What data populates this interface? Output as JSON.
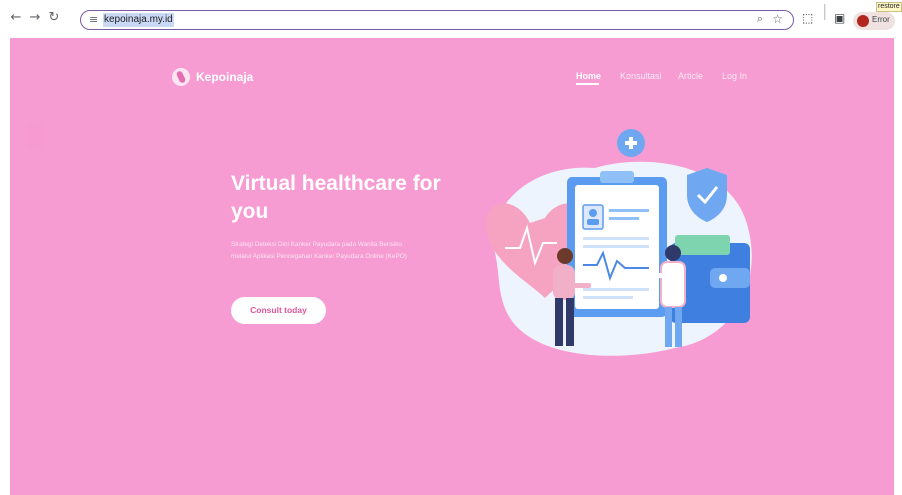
{
  "browser": {
    "back_icon": "←",
    "forward_icon": "→",
    "reload_icon": "↻",
    "tune_icon": "≡",
    "url": "kepoinaja.my.id",
    "zoom_icon": "⌕",
    "star_icon": "☆",
    "extensions_icon": "⬚",
    "sidebar_icon": "▣",
    "profile_label": "Error",
    "restore_label": "restore"
  },
  "site": {
    "brand": "Kepoinaja",
    "nav": {
      "home": "Home",
      "konsultasi": "Konsultasi",
      "article": "Article",
      "login": "Log In"
    }
  },
  "hero": {
    "title": "Virtual healthcare for you",
    "description": "Strategi Deteksi Dini Kanker Payudara pada Wanita Berisiko melalui Aplikasi Pencegahan Kanker Payudara Online (KePO)",
    "cta": "Consult today"
  },
  "colors": {
    "page_bg": "#f79bd3",
    "accent": "#e0559c"
  }
}
